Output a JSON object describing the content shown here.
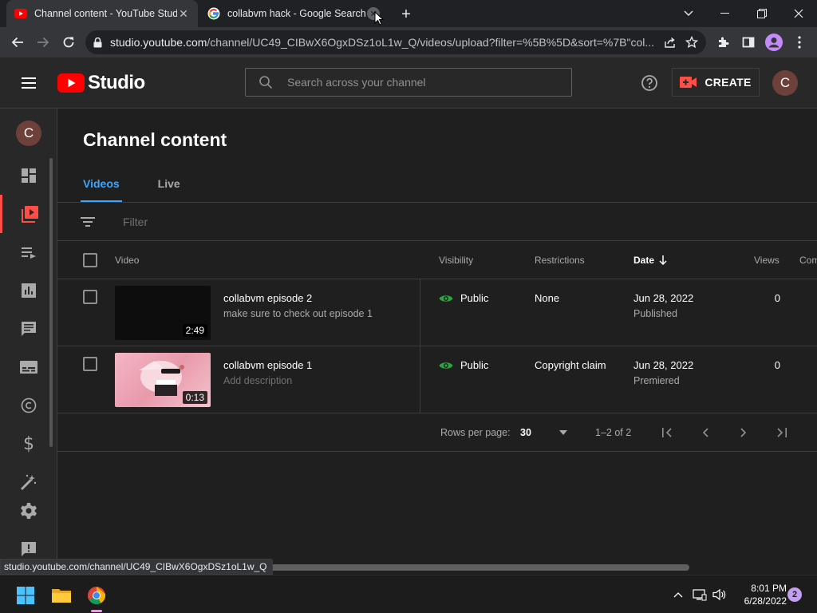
{
  "browser": {
    "tabs": [
      {
        "title": "Channel content - YouTube Studio",
        "favicon": "youtube-icon",
        "active": true
      },
      {
        "title": "collabvm hack - Google Search",
        "favicon": "google-icon",
        "active": false
      }
    ],
    "url_host": "studio.youtube.com",
    "url_path": "/channel/UC49_CIBwX6OgxDSz1oL1w_Q/videos/upload?filter=%5B%5D&sort=%7B\"col..."
  },
  "header": {
    "logo_text": "Studio",
    "search_placeholder": "Search across your channel",
    "create_label": "CREATE",
    "avatar_letter": "C"
  },
  "sidebar": {
    "avatar_letter": "C",
    "items": [
      {
        "name": "dashboard",
        "icon": "dashboard-icon"
      },
      {
        "name": "content",
        "icon": "content-icon",
        "active": true
      },
      {
        "name": "playlists",
        "icon": "playlists-icon"
      },
      {
        "name": "analytics",
        "icon": "analytics-icon"
      },
      {
        "name": "comments",
        "icon": "comments-icon"
      },
      {
        "name": "subtitles",
        "icon": "subtitles-icon"
      },
      {
        "name": "copyright",
        "icon": "copyright-icon"
      },
      {
        "name": "earn",
        "icon": "dollar-icon"
      },
      {
        "name": "customization",
        "icon": "magic-wand-icon"
      },
      {
        "name": "settings",
        "icon": "gear-icon"
      },
      {
        "name": "feedback",
        "icon": "feedback-icon"
      }
    ]
  },
  "main": {
    "title": "Channel content",
    "tabs": [
      {
        "label": "Videos",
        "active": true
      },
      {
        "label": "Live",
        "active": false
      }
    ],
    "filter_placeholder": "Filter",
    "columns": {
      "video": "Video",
      "visibility": "Visibility",
      "restrictions": "Restrictions",
      "date": "Date",
      "views": "Views",
      "comments": "Com"
    },
    "rows": [
      {
        "title": "collabvm episode 2",
        "description": "make sure to check out episode 1",
        "duration": "2:49",
        "visibility": "Public",
        "restrictions": "None",
        "date": "Jun 28, 2022",
        "date_status": "Published",
        "views": "0"
      },
      {
        "title": "collabvm episode 1",
        "description": "Add description",
        "duration": "0:13",
        "visibility": "Public",
        "restrictions": "Copyright claim",
        "date": "Jun 28, 2022",
        "date_status": "Premiered",
        "views": "0"
      }
    ],
    "pagination": {
      "rows_per_page_label": "Rows per page:",
      "rows_per_page": "30",
      "range": "1–2 of 2"
    }
  },
  "status_bar": {
    "url": "studio.youtube.com/channel/UC49_CIBwX6OgxDSz1oL1w_Q"
  },
  "taskbar": {
    "time": "8:01 PM",
    "date": "6/28/2022",
    "notification_count": "2"
  },
  "colors": {
    "accent_blue": "#3ea6ff",
    "youtube_red": "#ff0000",
    "public_green": "#2ba640"
  }
}
